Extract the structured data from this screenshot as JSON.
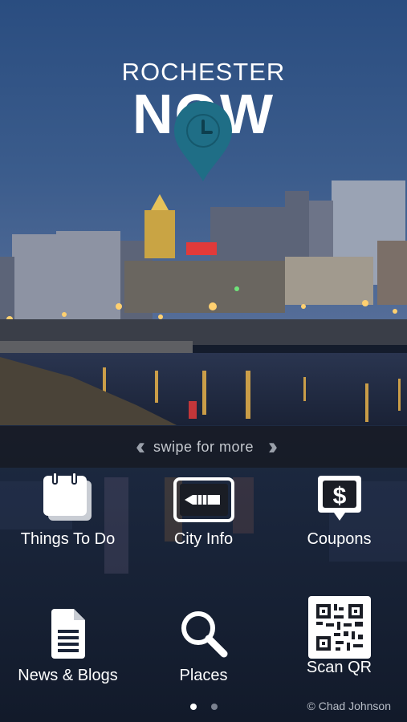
{
  "logo": {
    "line1": "ROCHESTER",
    "line2": "NOW"
  },
  "swipe": {
    "left_icon": "double-chevron-left-icon",
    "text": "swipe for more",
    "right_icon": "double-chevron-right-icon"
  },
  "tiles": [
    {
      "label": "Things To Do",
      "icon": "calendar-icon"
    },
    {
      "label": "City Info",
      "icon": "pencil-icon"
    },
    {
      "label": "Coupons",
      "icon": "dollar-tag-icon"
    },
    {
      "label": "News & Blogs",
      "icon": "document-icon"
    },
    {
      "label": "Places",
      "icon": "search-icon"
    },
    {
      "label": "Scan QR",
      "icon": "qr-code-icon"
    }
  ],
  "pager": {
    "pages": 2,
    "active": 1
  },
  "credit": "© Chad Johnson",
  "colors": {
    "pin": "#1f6e86",
    "swipe_bar": "#16181e",
    "lower_bg": "#1a2438"
  }
}
